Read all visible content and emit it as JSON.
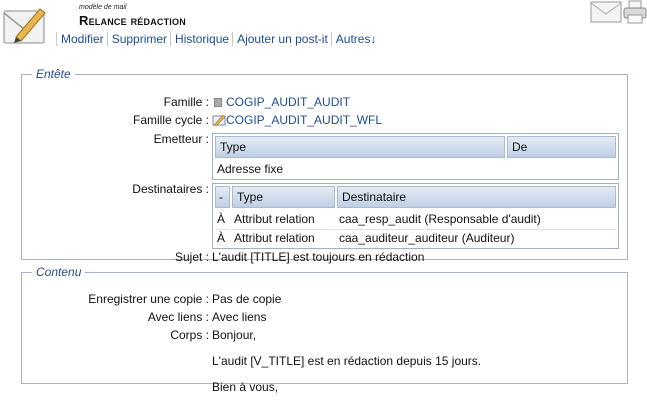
{
  "header": {
    "doc_type": "modèle de mail",
    "title": "Relance rédaction",
    "menu": [
      "Modifier",
      "Supprimer",
      "Historique",
      "Ajouter un post-it",
      "Autres↓"
    ]
  },
  "entete": {
    "legend": "Entête",
    "famille": {
      "label": "Famille :",
      "value": "COGIP_AUDIT_AUDIT"
    },
    "famille_cycle": {
      "label": "Famille cycle :",
      "value": "COGIP_AUDIT_AUDIT_WFL"
    },
    "emetteur": {
      "label": "Emetteur :",
      "headers": [
        "Type",
        "De"
      ],
      "rows": [
        [
          "Adresse fixe",
          ""
        ]
      ]
    },
    "destinataires": {
      "label": "Destinataires :",
      "headers": [
        "-",
        "Type",
        "Destinataire"
      ],
      "rows": [
        [
          "À",
          "Attribut relation",
          "caa_resp_audit (Responsable d'audit)"
        ],
        [
          "À",
          "Attribut relation",
          "caa_auditeur_auditeur (Auditeur)"
        ]
      ]
    },
    "sujet": {
      "label": "Sujet :",
      "value": "L'audit [TITLE] est toujours en rédaction"
    }
  },
  "contenu": {
    "legend": "Contenu",
    "copie": {
      "label": "Enregistrer une copie :",
      "value": "Pas de copie"
    },
    "liens": {
      "label": "Avec liens :",
      "value": "Avec liens"
    },
    "corps": {
      "label": "Corps :",
      "lines": [
        "Bonjour,",
        "L'audit [V_TITLE] est en rédaction depuis 15 jours.",
        "Bien à vous,"
      ]
    }
  },
  "colors": {
    "link": "#1d4e9a",
    "legend": "#2a4b86",
    "border": "#a8b4c4"
  },
  "icons": [
    "mail-template-icon",
    "envelope-icon",
    "printer-icon",
    "document-icon",
    "workflow-icon"
  ]
}
